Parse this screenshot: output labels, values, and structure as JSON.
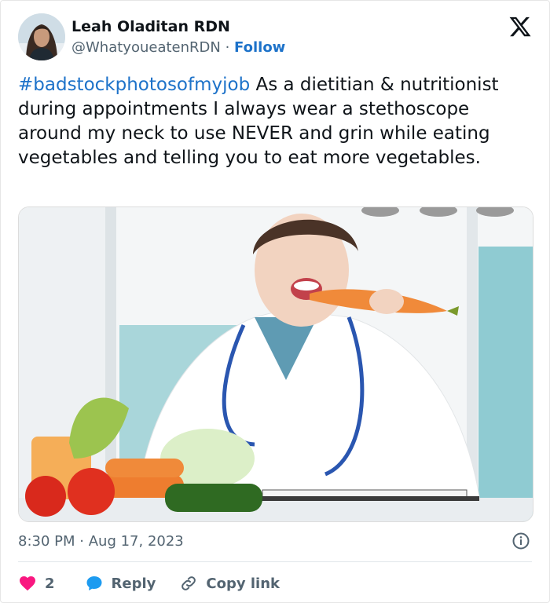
{
  "author": {
    "name": "Leah Oladitan RDN",
    "handle": "@WhatyoueatenRDN",
    "separator": "·",
    "follow_label": "Follow"
  },
  "brand_icon": "x-logo-icon",
  "tweet": {
    "hashtag": "#badstockphotosofmyjob",
    "text": " As a dietitian & nutritionist during appointments I always wear a stethoscope around my neck to use NEVER and grin while eating vegetables and telling you to eat more vegetables."
  },
  "media": {
    "description_icon": "stock-photo-dietitian-eating-carrot"
  },
  "meta": {
    "time": "8:30 PM",
    "separator": "·",
    "date": "Aug 17, 2023",
    "info_icon": "info-icon"
  },
  "actions": {
    "like_count": "2",
    "reply_label": "Reply",
    "copy_label": "Copy link"
  },
  "colors": {
    "link": "#1d72c9",
    "like": "#f91880",
    "reply": "#1d9bf0",
    "muted": "#536471"
  }
}
